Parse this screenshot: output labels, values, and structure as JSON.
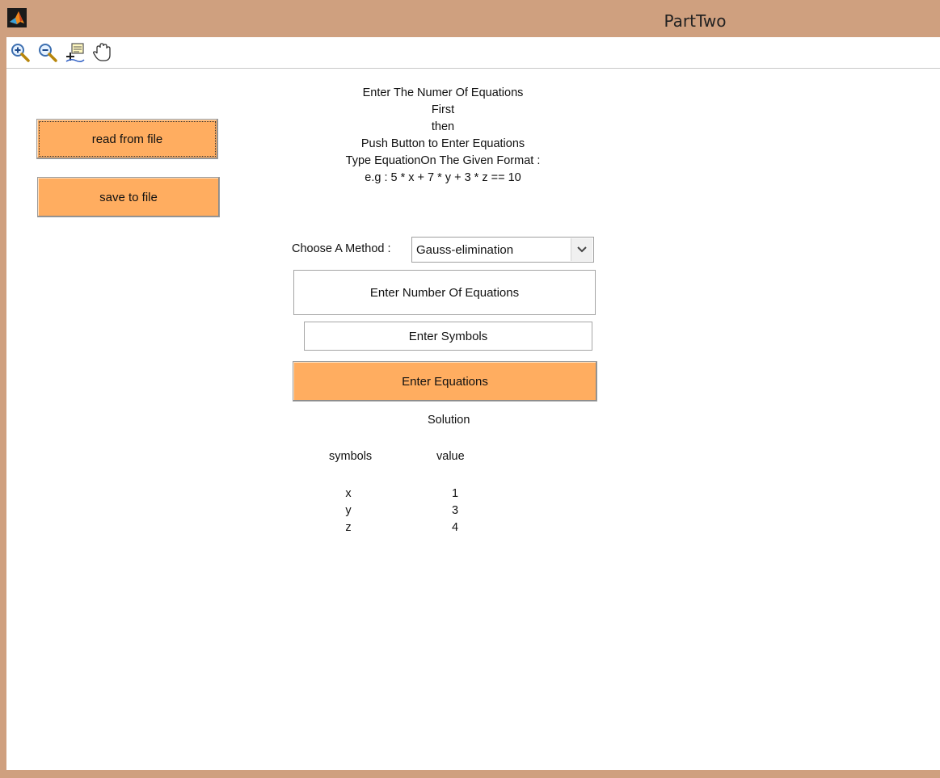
{
  "window": {
    "title": "PartTwo"
  },
  "toolbar": {
    "items": [
      {
        "icon": "zoom-in-icon"
      },
      {
        "icon": "zoom-out-icon"
      },
      {
        "icon": "data-cursor-icon"
      },
      {
        "icon": "pan-hand-icon"
      }
    ]
  },
  "buttons": {
    "read_from_file": "read from file",
    "save_to_file": "save to file",
    "enter_equations": "Enter Equations"
  },
  "instructions": [
    "Enter The Numer Of Equations",
    "First",
    "then",
    "Push Button to Enter Equations",
    "Type EquationOn The Given Format :",
    "e.g : 5 * x + 7 * y + 3 * z == 10"
  ],
  "method": {
    "label": "Choose A Method :",
    "selected": "Gauss-elimination"
  },
  "inputs": {
    "num_equations": "Enter Number Of Equations",
    "symbols": "Enter Symbols"
  },
  "solution": {
    "title": "Solution",
    "headers": {
      "symbols": "symbols",
      "value": "value"
    },
    "rows": [
      {
        "symbol": "x",
        "value": "1"
      },
      {
        "symbol": "y",
        "value": "3"
      },
      {
        "symbol": "z",
        "value": "4"
      }
    ]
  },
  "colors": {
    "frame": "#cfa07f",
    "button": "#ffad60"
  }
}
